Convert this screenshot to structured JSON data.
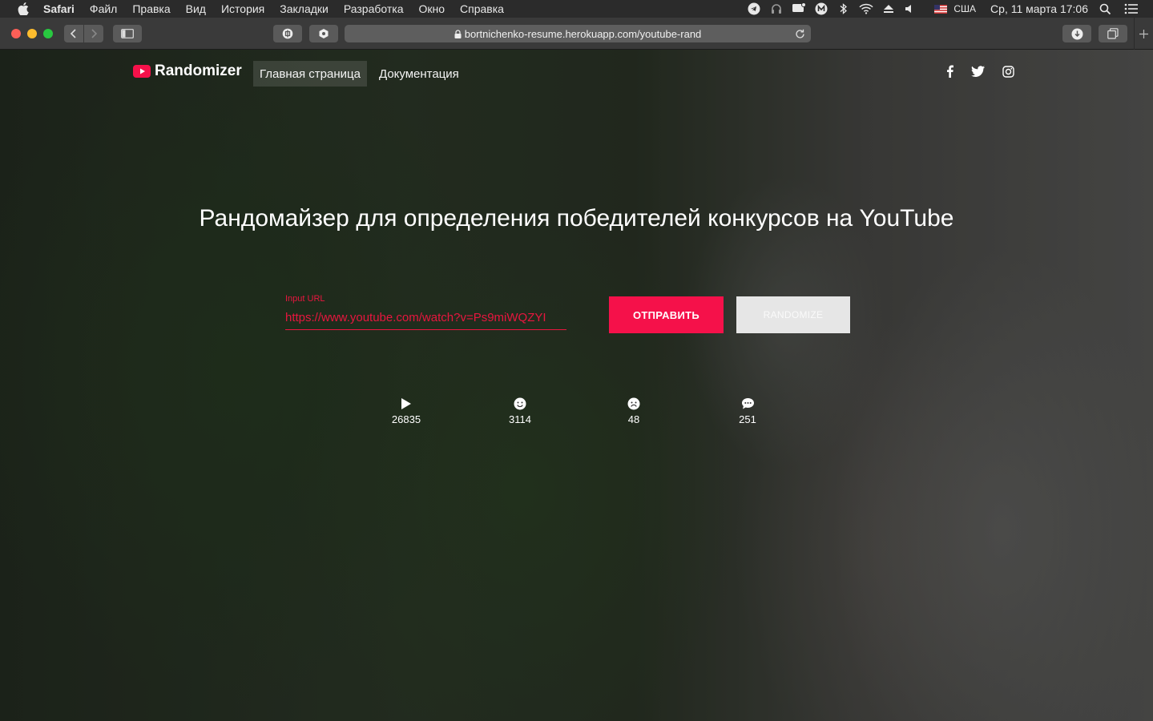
{
  "menubar": {
    "app": "Safari",
    "items": [
      "Файл",
      "Правка",
      "Вид",
      "История",
      "Закладки",
      "Разработка",
      "Окно",
      "Справка"
    ],
    "input_source": "США",
    "datetime": "Ср, 11 марта  17:06"
  },
  "browser": {
    "address": "bortnichenko-resume.herokuapp.com/youtube-rand"
  },
  "site": {
    "brand": "Randomizer",
    "nav": [
      "Главная страница",
      "Документация"
    ],
    "headline": "Рандомайзер для определения победителей конкурсов на YouTube",
    "input_label": "Input URL",
    "input_value": "https://www.youtube.com/watch?v=Ps9miWQZYI",
    "send_button": "ОТПРАВИТЬ",
    "randomize_button": "RANDOMIZE",
    "stats": [
      {
        "icon": "play-icon",
        "value": "26835"
      },
      {
        "icon": "smile-icon",
        "value": "3114"
      },
      {
        "icon": "frown-icon",
        "value": "48"
      },
      {
        "icon": "comment-icon",
        "value": "251"
      }
    ],
    "accent_color": "#f5114a"
  }
}
